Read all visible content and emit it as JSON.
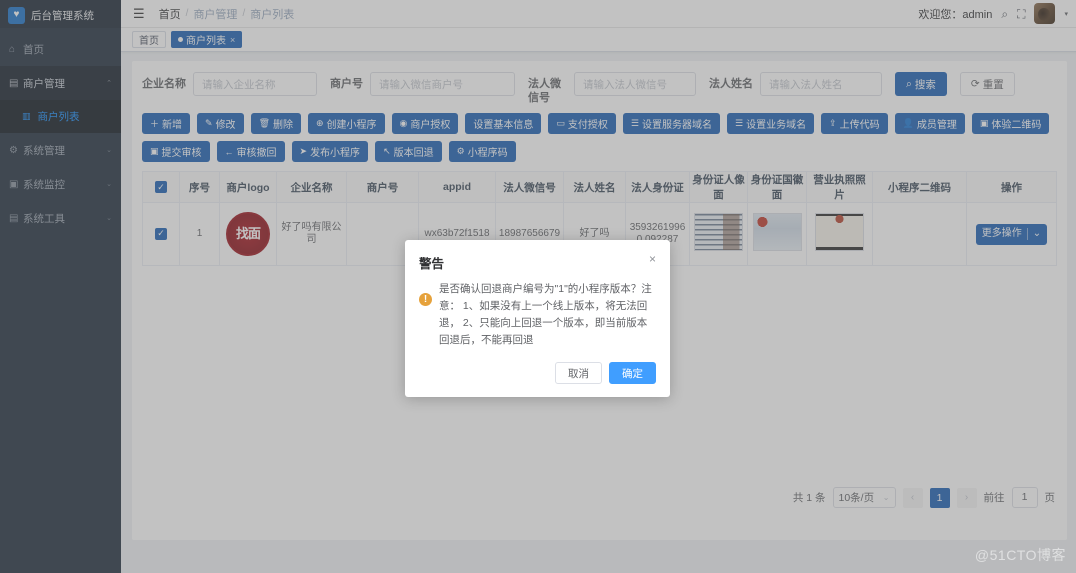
{
  "sidebar": {
    "brand": {
      "title": "后台管理系统",
      "logo_icon": "heart-icon"
    },
    "items": [
      {
        "label": "首页",
        "icon": "home-icon",
        "arrow": "",
        "state": "normal"
      },
      {
        "label": "商户管理",
        "icon": "shop-icon",
        "arrow": "⌃",
        "state": "open"
      },
      {
        "label": "商户列表",
        "icon": "list-icon",
        "arrow": "",
        "state": "sub-active"
      },
      {
        "label": "系统管理",
        "icon": "gear-icon",
        "arrow": "⌄",
        "state": "normal"
      },
      {
        "label": "系统监控",
        "icon": "monitor-icon",
        "arrow": "⌄",
        "state": "normal"
      },
      {
        "label": "系统工具",
        "icon": "toolbox-icon",
        "arrow": "⌄",
        "state": "normal"
      }
    ]
  },
  "topbar": {
    "hamburger_icon": "menu-collapse-icon",
    "breadcrumb": [
      "首页",
      "商户管理",
      "商户列表"
    ],
    "separator": "/",
    "welcome": "欢迎您：admin",
    "search_icon": "search-icon",
    "fullscreen_icon": "fullscreen-icon",
    "avatar_name": "avatar",
    "caret": "▾"
  },
  "tags": [
    {
      "label": "首页",
      "active": false,
      "closable": false
    },
    {
      "label": "商户列表",
      "active": true,
      "closable": true,
      "close": "×"
    }
  ],
  "search_form": {
    "fields": [
      {
        "label": "企业名称",
        "placeholder": "请输入企业名称",
        "value": ""
      },
      {
        "label": "商户号",
        "placeholder": "请输入微信商户号",
        "value": ""
      },
      {
        "label": "法人微信号",
        "placeholder": "请输入法人微信号",
        "value": ""
      },
      {
        "label": "法人姓名",
        "placeholder": "请输入法人姓名",
        "value": ""
      }
    ],
    "search_label": "搜索",
    "search_icon": "search-icon",
    "reset_label": "重置",
    "reset_icon": "refresh-icon"
  },
  "toolbar": {
    "buttons": [
      {
        "label": "新增",
        "icon": "plus-icon"
      },
      {
        "label": "修改",
        "icon": "pencil-icon"
      },
      {
        "label": "删除",
        "icon": "trash-icon"
      },
      {
        "label": "创建小程序",
        "icon": "circle-plus-icon"
      },
      {
        "label": "商户授权",
        "icon": "target-icon"
      },
      {
        "label": "设置基本信息",
        "icon": ""
      },
      {
        "label": "支付授权",
        "icon": "card-icon"
      },
      {
        "label": "设置服务器域名",
        "icon": "list-lines-icon"
      },
      {
        "label": "设置业务域名",
        "icon": "list-lines-icon"
      },
      {
        "label": "上传代码",
        "icon": "upload-icon"
      },
      {
        "label": "成员管理",
        "icon": "user-icon"
      },
      {
        "label": "体验二维码",
        "icon": "qr-icon"
      },
      {
        "label": "提交审核",
        "icon": "qr-icon"
      },
      {
        "label": "审核撤回",
        "icon": "arrow-left-icon"
      },
      {
        "label": "发布小程序",
        "icon": "send-icon"
      },
      {
        "label": "版本回退",
        "icon": "rollback-icon"
      },
      {
        "label": "小程序码",
        "icon": "gear-icon"
      }
    ]
  },
  "table": {
    "select_all_checked": true,
    "columns": [
      "序号",
      "商户logo",
      "企业名称",
      "商户号",
      "appid",
      "法人微信号",
      "法人姓名",
      "法人身份证",
      "身份证人像面",
      "身份证国徽面",
      "营业执照照片",
      "小程序二维码",
      "操作"
    ],
    "rows": [
      {
        "checked": true,
        "index": "1",
        "logo_text": "找面",
        "logo_name": "merchant-logo-stamp",
        "company": "好了吗有限公司",
        "merchant_no": "",
        "appid": "wx63b72f1518",
        "legal_wechat": "18987656679",
        "legal_name": "好了吗",
        "legal_id": "35932619960 092287",
        "id_front_name": "id-card-portrait-image",
        "id_back_name": "id-card-emblem-image",
        "license_name": "business-license-image",
        "qrcode": "",
        "action_label": "更多操作",
        "action_caret": "⌄"
      }
    ]
  },
  "pagination": {
    "total_text": "共 1 条",
    "page_size": "10条/页",
    "page_size_caret": "⌄",
    "prev": "‹",
    "next": "›",
    "current_page": "1",
    "jump_label": "前往",
    "jump_value": "1",
    "jump_unit": "页"
  },
  "dialog": {
    "title": "警告",
    "close": "×",
    "warn_icon": "warning-icon",
    "message": "是否确认回退商户编号为\"1\"的小程序版本？注意： 1、如果没有上一个线上版本，将无法回退， 2、只能向上回退一个版本，即当前版本回退后，不能再回退",
    "cancel_label": "取消",
    "confirm_label": "确定"
  },
  "watermark": "@51CTO博客",
  "colors": {
    "sidebar_bg": "#1f2d3d",
    "primary": "#1a5fb4",
    "dialog_confirm": "#409eff",
    "warning": "#e6a23c",
    "stamp_red": "#8d1119"
  }
}
